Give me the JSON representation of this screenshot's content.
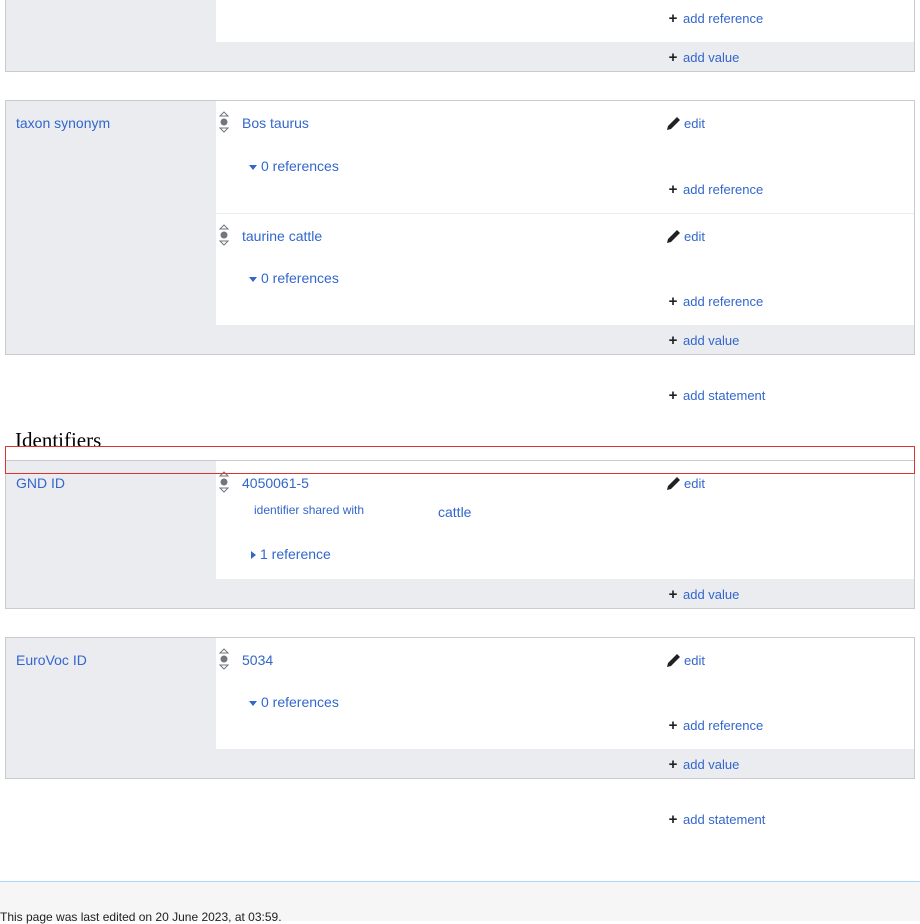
{
  "top_partial": {
    "add_reference": "add reference",
    "add_value": "add value"
  },
  "taxon_synonym": {
    "property": "taxon synonym",
    "statements": [
      {
        "value": "Bos taurus",
        "edit": "edit",
        "references": "0 references",
        "add_reference": "add reference"
      },
      {
        "value": "taurine cattle",
        "edit": "edit",
        "references": "0 references",
        "add_reference": "add reference"
      }
    ],
    "add_value": "add value"
  },
  "add_statement_1": "add statement",
  "identifiers_heading": "Identifiers",
  "gnd_id": {
    "property": "GND ID",
    "value": "4050061-5",
    "edit": "edit",
    "qualifier_property": "identifier shared with",
    "qualifier_value": "cattle",
    "references": "1 reference",
    "add_value": "add value"
  },
  "eurovoc_id": {
    "property": "EuroVoc ID",
    "value": "5034",
    "edit": "edit",
    "references": "0 references",
    "add_reference": "add reference",
    "add_value": "add value"
  },
  "add_statement_2": "add statement",
  "footer": {
    "last_edited": "This page was last edited on 20 June 2023, at 03:59."
  },
  "icons": {
    "plus": "plus-icon",
    "edit": "pencil-icon",
    "rank": "normal-rank-icon"
  },
  "colors": {
    "link": "#3366cc",
    "group_bg": "#eaecf0",
    "border": "#c8ccd1",
    "highlight_box": "#dd3333"
  }
}
